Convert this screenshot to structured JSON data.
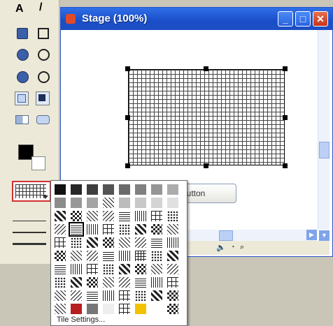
{
  "window": {
    "title": "Stage (100%)",
    "minimize": "_",
    "maximize": "□",
    "close": "✕"
  },
  "stage": {
    "button_label": "Button"
  },
  "statusbar": {
    "speaker": "🔈",
    "dots": "⠂",
    "zoom": "⌕"
  },
  "toolbox": {
    "tools": [
      {
        "name": "text-tool-icon",
        "glyph": "A"
      },
      {
        "name": "pencil-tool-icon",
        "glyph": "/"
      },
      {
        "name": "filled-rect-icon",
        "glyph": ""
      },
      {
        "name": "rect-outline-icon",
        "glyph": ""
      },
      {
        "name": "filled-ellipse-icon",
        "glyph": ""
      },
      {
        "name": "ellipse-outline-icon",
        "glyph": ""
      },
      {
        "name": "filled-circle-icon",
        "glyph": ""
      },
      {
        "name": "circle-outline-icon",
        "glyph": ""
      },
      {
        "name": "field-tool-icon",
        "glyph": ""
      },
      {
        "name": "checkbox-tool-icon",
        "glyph": ""
      },
      {
        "name": "menu-tool-icon",
        "glyph": ""
      },
      {
        "name": "button-tool-icon",
        "glyph": ""
      }
    ]
  },
  "popup": {
    "footer": "Tile Settings...",
    "colors": {
      "red": "#b81e1e",
      "yellow": "#f2c200",
      "gray_dark": "#3a3a3a",
      "gray_mid": "#8a8a8a"
    }
  }
}
